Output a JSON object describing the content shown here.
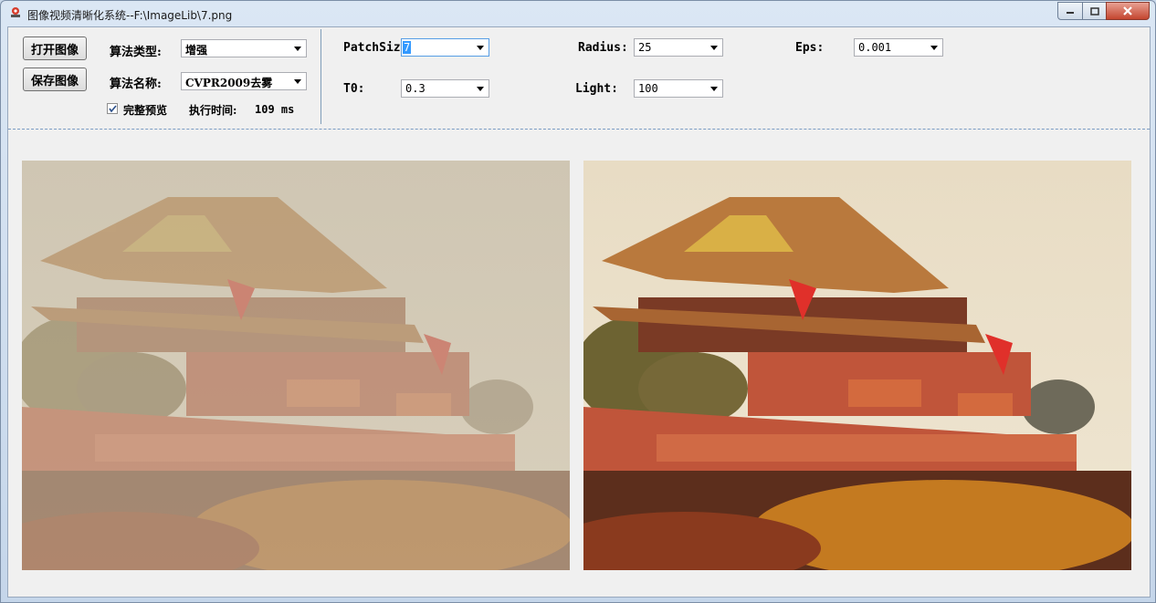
{
  "window": {
    "title": "图像视频清晰化系统--F:\\ImageLib\\7.png"
  },
  "icons": {
    "app": "app-icon",
    "minimize": "minimize-icon",
    "maximize": "maximize-icon",
    "close": "close-icon",
    "check": "checkmark-icon",
    "dropdown": "dropdown-arrow-icon"
  },
  "buttons": {
    "open": "打开图像",
    "save": "保存图像"
  },
  "algorithm": {
    "type_label": "算法类型:",
    "type_value": "增强",
    "name_label": "算法名称:",
    "name_value": "CVPR2009去雾"
  },
  "preview": {
    "label": "完整预览",
    "checked": true
  },
  "exec_time": {
    "label": "执行时间:",
    "value": "109 ms"
  },
  "params": {
    "patchsize_label": "PatchSiz",
    "patchsize_value": "7",
    "radius_label": "Radius:",
    "radius_value": "25",
    "eps_label": "Eps:",
    "eps_value": "0.001",
    "t0_label": "T0:",
    "t0_value": "0.3",
    "light_label": "Light:",
    "light_value": "100"
  },
  "images": {
    "left": {
      "description_name": "hazy-input-image"
    },
    "right": {
      "description_name": "dehazed-output-image"
    }
  },
  "colors": {
    "hazy_sky": "#d6ccb5",
    "clear_sky": "#efe6d2",
    "wall_red": "#c0553a",
    "roof": "#b9793d"
  }
}
